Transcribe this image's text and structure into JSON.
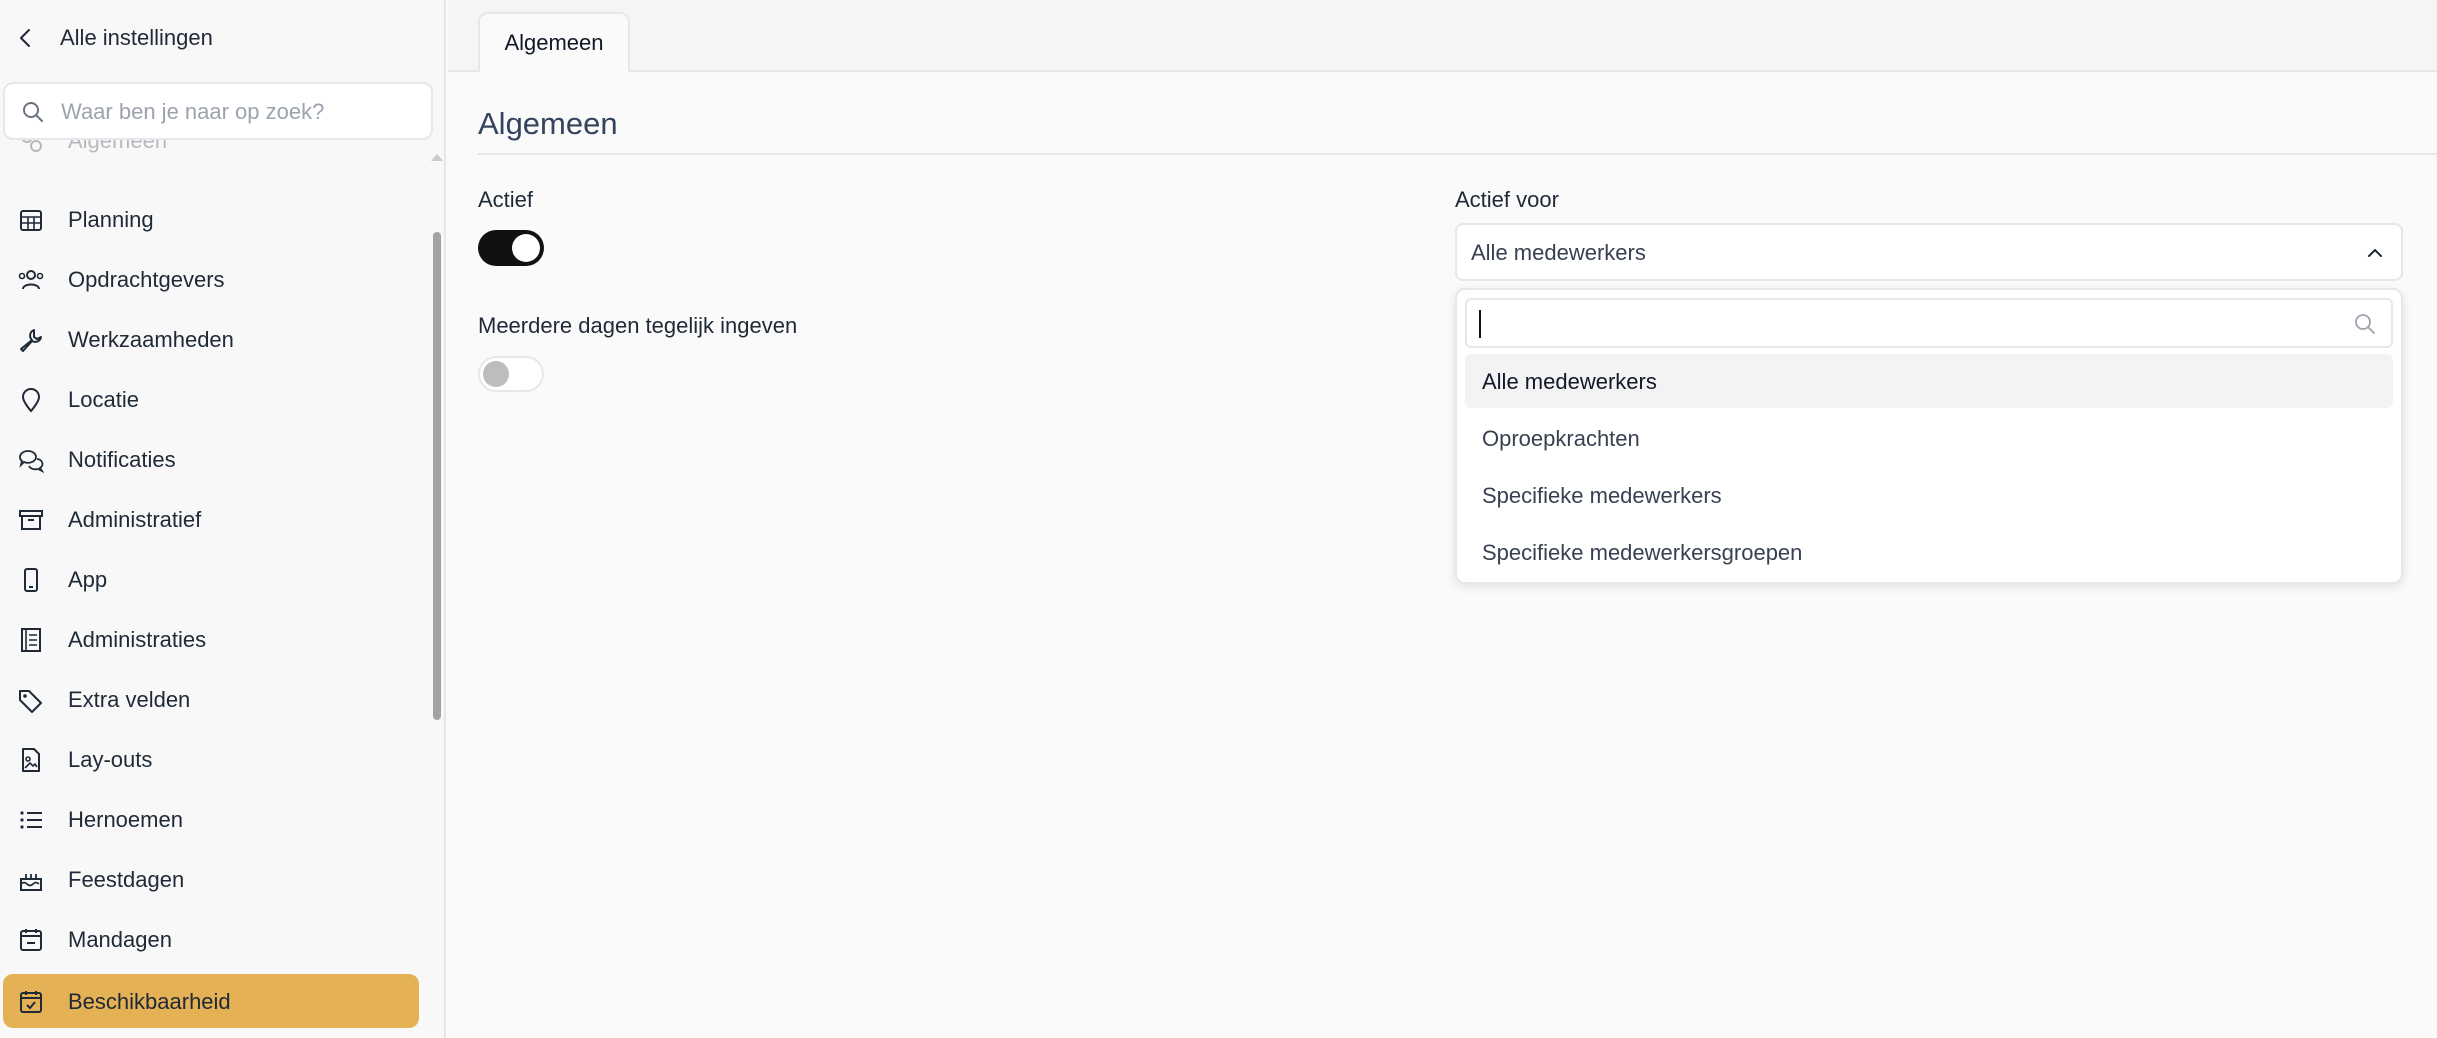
{
  "sidebar": {
    "back_label": "Alle instellingen",
    "search_placeholder": "Waar ben je naar op zoek?",
    "items": [
      {
        "label": "Algemeen",
        "icon": "gears-icon"
      },
      {
        "label": "Planning",
        "icon": "calendar-grid-icon"
      },
      {
        "label": "Opdrachtgevers",
        "icon": "users-icon"
      },
      {
        "label": "Werkzaamheden",
        "icon": "wrench-icon"
      },
      {
        "label": "Locatie",
        "icon": "map-pin-icon"
      },
      {
        "label": "Notificaties",
        "icon": "chat-bubbles-icon"
      },
      {
        "label": "Administratief",
        "icon": "archive-icon"
      },
      {
        "label": "App",
        "icon": "smartphone-icon"
      },
      {
        "label": "Administraties",
        "icon": "ledger-icon"
      },
      {
        "label": "Extra velden",
        "icon": "tags-icon"
      },
      {
        "label": "Lay-outs",
        "icon": "file-image-icon"
      },
      {
        "label": "Hernoemen",
        "icon": "list-icon"
      },
      {
        "label": "Feestdagen",
        "icon": "cake-icon"
      },
      {
        "label": "Mandagen",
        "icon": "calendar-minus-icon"
      },
      {
        "label": "Beschikbaarheid",
        "icon": "calendar-check-icon"
      }
    ],
    "active_item": "Beschikbaarheid"
  },
  "tabs": [
    {
      "label": "Algemeen",
      "active": true
    }
  ],
  "main": {
    "section_title": "Algemeen",
    "actief": {
      "label": "Actief",
      "value": true
    },
    "meerdere_dagen": {
      "label": "Meerdere dagen tegelijk ingeven",
      "value": false
    },
    "actief_voor": {
      "label": "Actief voor",
      "selected": "Alle medewerkers",
      "options": [
        "Alle medewerkers",
        "Oproepkrachten",
        "Specifieke medewerkers",
        "Specifieke medewerkersgroepen"
      ]
    }
  },
  "colors": {
    "accent": "#e4b154",
    "toggle_on": "#111111",
    "title": "#34435e"
  }
}
